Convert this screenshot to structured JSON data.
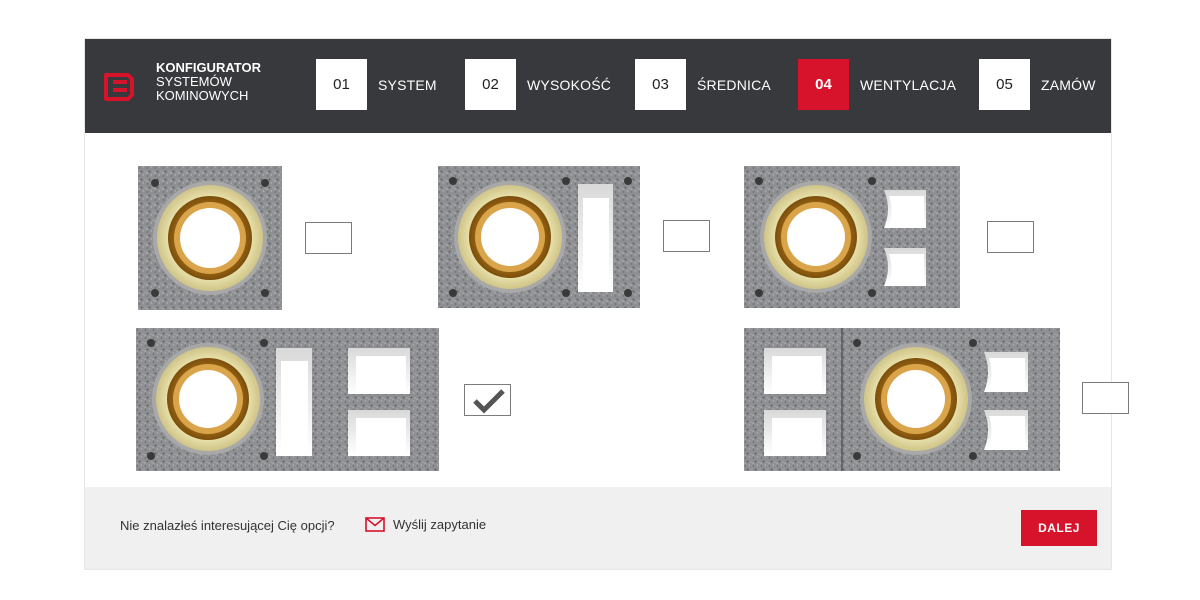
{
  "brand": {
    "line1": "KONFIGURATOR",
    "line2": "SYSTEMÓW",
    "line3": "KOMINOWYCH",
    "accent": "#d6132a",
    "header_bg": "#37393c"
  },
  "steps": [
    {
      "num": "01",
      "label": "SYSTEM",
      "active": false
    },
    {
      "num": "02",
      "label": "WYSOKOŚĆ",
      "active": false
    },
    {
      "num": "03",
      "label": "ŚREDNICA",
      "active": false
    },
    {
      "num": "04",
      "label": "WENTYLACJA",
      "active": true
    },
    {
      "num": "05",
      "label": "ZAMÓW",
      "active": false
    }
  ],
  "options": [
    {
      "id": "single-flue",
      "checked": false
    },
    {
      "id": "flue-one-vent",
      "checked": false
    },
    {
      "id": "flue-two-vents",
      "checked": false
    },
    {
      "id": "flue-vent-two-vents",
      "checked": true
    },
    {
      "id": "vents-flue-vents",
      "checked": false
    }
  ],
  "footer": {
    "question": "Nie znalazłeś interesującej Cię opcji?",
    "send_inquiry": "Wyślij zapytanie",
    "next_label": "DALEJ",
    "icon": "mail-icon"
  }
}
